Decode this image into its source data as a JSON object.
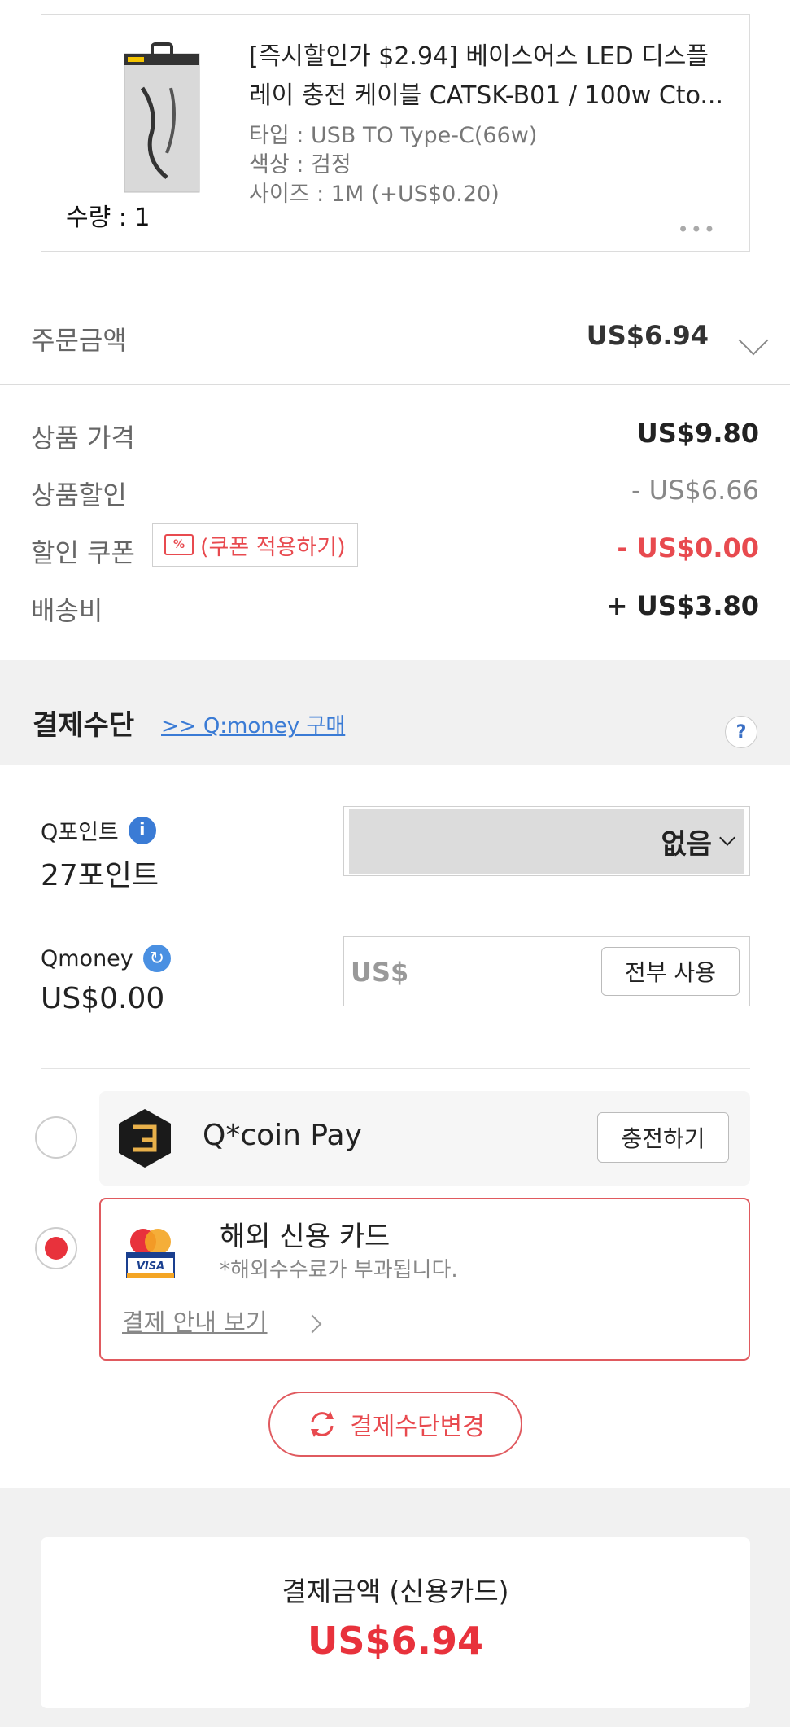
{
  "product": {
    "title_line1": "[즉시할인가 $2.94] 베이스어스 LED 디스플",
    "title_line2": "레이 충전 케이블 CATSK-B01 / 100w Cto...",
    "quantity": "수량 : 1",
    "options": [
      "타입 : USB TO Type-C(66w)",
      "색상 : 검정",
      "사이즈 : 1M (+US$0.20)"
    ],
    "more": "•••"
  },
  "order": {
    "label": "주문금액",
    "value": "US$6.94"
  },
  "breakdown": {
    "item_price_label": "상품 가격",
    "item_price_value": "US$9.80",
    "item_discount_label": "상품할인",
    "item_discount_value": "- US$6.66",
    "coupon_label": "할인 쿠폰",
    "coupon_button": "(쿠폰 적용하기)",
    "coupon_value": "- US$0.00",
    "shipping_label": "배송비",
    "shipping_value": "+ US$3.80"
  },
  "payment": {
    "title": "결제수단",
    "qmoney_link": ">> Q:money 구매",
    "help": "?",
    "qpoint_label": "Q포인트",
    "qpoint_value": "27포인트",
    "qpoint_select": "없음",
    "qmoney_label": "Qmoney",
    "qmoney_value": "US$0.00",
    "qmoney_prefix": "US$",
    "use_all": "전부 사용",
    "qcoin_label": "Q*coin Pay",
    "charge": "충전하기",
    "card_title": "해외 신용 카드",
    "card_note": "*해외수수료가 부과됩니다.",
    "card_guide": "결제 안내 보기",
    "change_method": "결제수단변경"
  },
  "total": {
    "label": "결제금액 (신용카드)",
    "value": "US$6.94"
  },
  "colors": {
    "accent_red": "#e8323c",
    "link_blue": "#3a7bd5"
  }
}
